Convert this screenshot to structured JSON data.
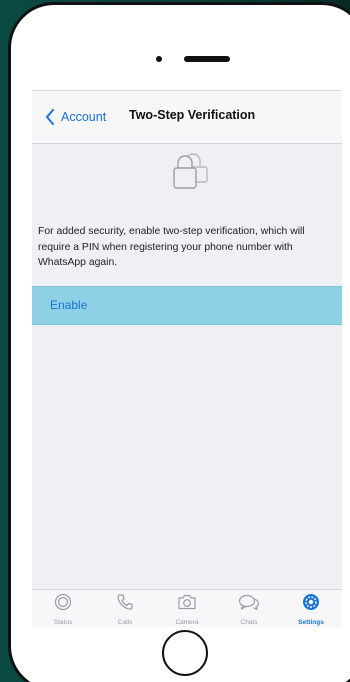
{
  "navbar": {
    "back_label": "Account",
    "title": "Two-Step Verification"
  },
  "icons": {
    "back": "chevron-left-icon",
    "lock": "lock-icon"
  },
  "description": "For added security, enable two-step verification, which will require a PIN when registering your phone number with WhatsApp again.",
  "enable_label": "Enable",
  "tabs": [
    {
      "label": "Status",
      "icon": "status-icon",
      "active": false
    },
    {
      "label": "Calls",
      "icon": "phone-icon",
      "active": false
    },
    {
      "label": "Camera",
      "icon": "camera-icon",
      "active": false
    },
    {
      "label": "Chats",
      "icon": "chat-bubbles-icon",
      "active": false
    },
    {
      "label": "Settings",
      "icon": "gear-icon",
      "active": true
    }
  ],
  "colors": {
    "accent": "#1a73d9",
    "selected_row": "#8ed0e6",
    "background": "#efeff4",
    "frame_background": "#0b4a42"
  }
}
